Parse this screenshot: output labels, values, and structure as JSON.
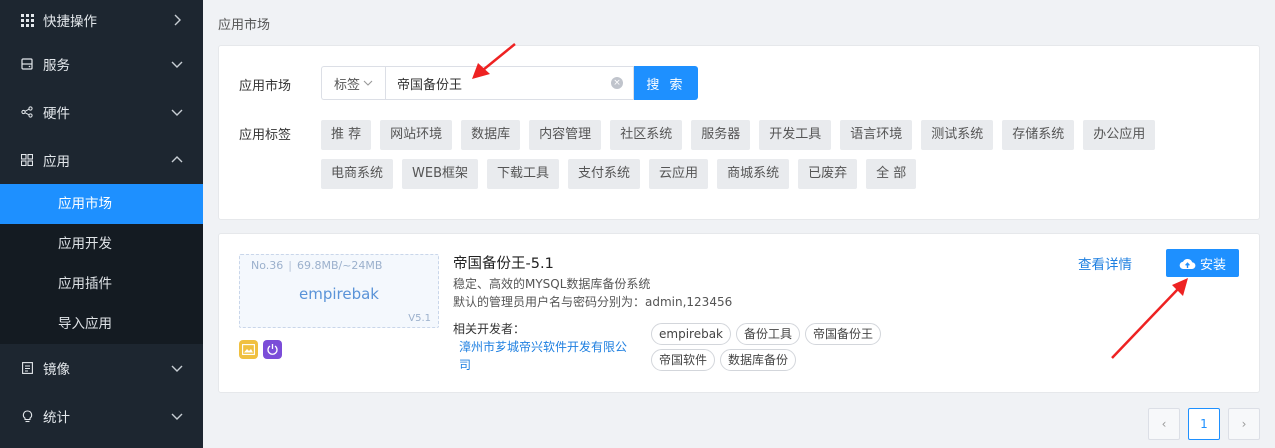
{
  "sidebar": {
    "groups": [
      {
        "label": "快捷操作",
        "icon": "grid-icon",
        "chevron": "chevron-right-icon"
      },
      {
        "label": "服务",
        "icon": "server-icon",
        "chevron": "chevron-down-icon"
      },
      {
        "label": "硬件",
        "icon": "share-icon",
        "chevron": "chevron-down-icon"
      },
      {
        "label": "应用",
        "icon": "apps-icon",
        "chevron": "chevron-up-icon"
      },
      {
        "label": "镜像",
        "icon": "document-icon",
        "chevron": "chevron-down-icon"
      },
      {
        "label": "统计",
        "icon": "bulb-icon",
        "chevron": "chevron-down-icon"
      }
    ],
    "sub_items": [
      "应用市场",
      "应用开发",
      "应用插件",
      "导入应用"
    ],
    "active_item": "应用市场"
  },
  "breadcrumb": "应用市场",
  "search": {
    "label": "应用市场",
    "select_value": "标签",
    "input_value": "帝国备份王",
    "button": "搜 索"
  },
  "tags": {
    "label": "应用标签",
    "items": [
      "推 荐",
      "网站环境",
      "数据库",
      "内容管理",
      "社区系统",
      "服务器",
      "开发工具",
      "语言环境",
      "测试系统",
      "存储系统",
      "办公应用",
      "电商系统",
      "WEB框架",
      "下载工具",
      "支付系统",
      "云应用",
      "商城系统",
      "已废弃",
      "全 部"
    ]
  },
  "app": {
    "number": "No.36",
    "size": "69.8MB/~24MB",
    "thumb_name": "empirebak",
    "version": "V5.1",
    "title": "帝国备份王-5.1",
    "description": "稳定、高效的MYSQL数据库备份系统",
    "credentials": "默认的管理员用户名与密码分别为：admin,123456",
    "developer_label": "相关开发者：",
    "developer": "漳州市芗城帝兴软件开发有限公司",
    "tags": [
      "empirebak",
      "备份工具",
      "帝国备份王",
      "帝国软件",
      "数据库备份"
    ],
    "detail_link": "查看详情",
    "install_button": "安装"
  },
  "pagination": {
    "prev": "‹",
    "current": "1",
    "next": "›"
  },
  "colors": {
    "sidebar_bg": "#1d2630",
    "accent": "#1e90ff",
    "annotation_arrow": "#ee2222"
  }
}
